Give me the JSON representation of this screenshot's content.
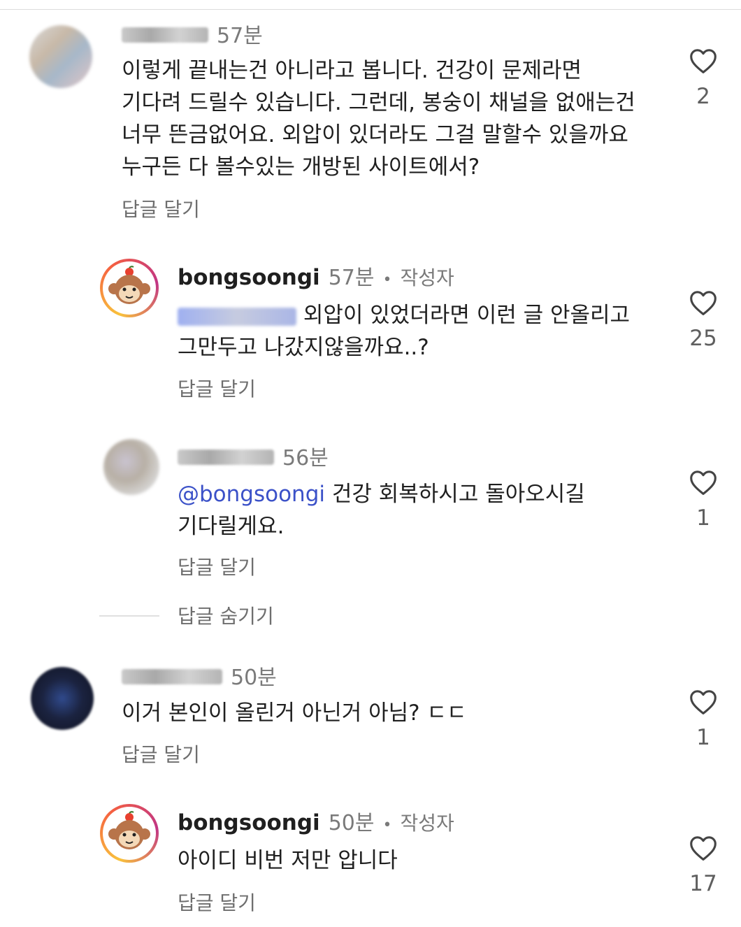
{
  "comments": [
    {
      "time": "57분",
      "lines": [
        "이렇게 끝내는건 아니라고 봅니다. 건강이 문제라면",
        "기다려 드릴수 있습니다. 그런데, 봉숭이 채널을 없애는건",
        "너무 뜬금없어요. 외압이 있더라도 그걸 말할수 있을까요",
        "누구든 다 볼수있는 개방된 사이트에서?"
      ],
      "reply": "답글 달기",
      "likes": "2"
    },
    {
      "username": "bongsoongi",
      "time": "57분",
      "author_tag": "작성자",
      "line1_rest": " 외압이 있었더라면 이런 글 안올리고",
      "line2": "그만두고 나갔지않을까요..?",
      "reply": "답글 달기",
      "likes": "25"
    },
    {
      "time": "56분",
      "mention": "@bongsoongi",
      "line1_rest": " 건강 회복하시고 돌아오시길",
      "line2": "기다릴게요.",
      "reply": "답글 달기",
      "likes": "1"
    },
    {
      "time": "50분",
      "line1": "이거 본인이 올린거 아닌거 아님? ㄷㄷ",
      "reply": "답글 달기",
      "likes": "1"
    },
    {
      "username": "bongsoongi",
      "time": "50분",
      "author_tag": "작성자",
      "line1": "아이디 비번 저만 압니다",
      "reply": "답글 달기",
      "likes": "17"
    }
  ],
  "hide_replies": "답글 숨기기",
  "icons": {
    "like": "heart-outline-icon",
    "avatar_owner": "monkey-avatar-icon"
  },
  "colors": {
    "mention": "#3b51c8",
    "muted": "#7a7a7a",
    "text": "#1f1f1f"
  }
}
